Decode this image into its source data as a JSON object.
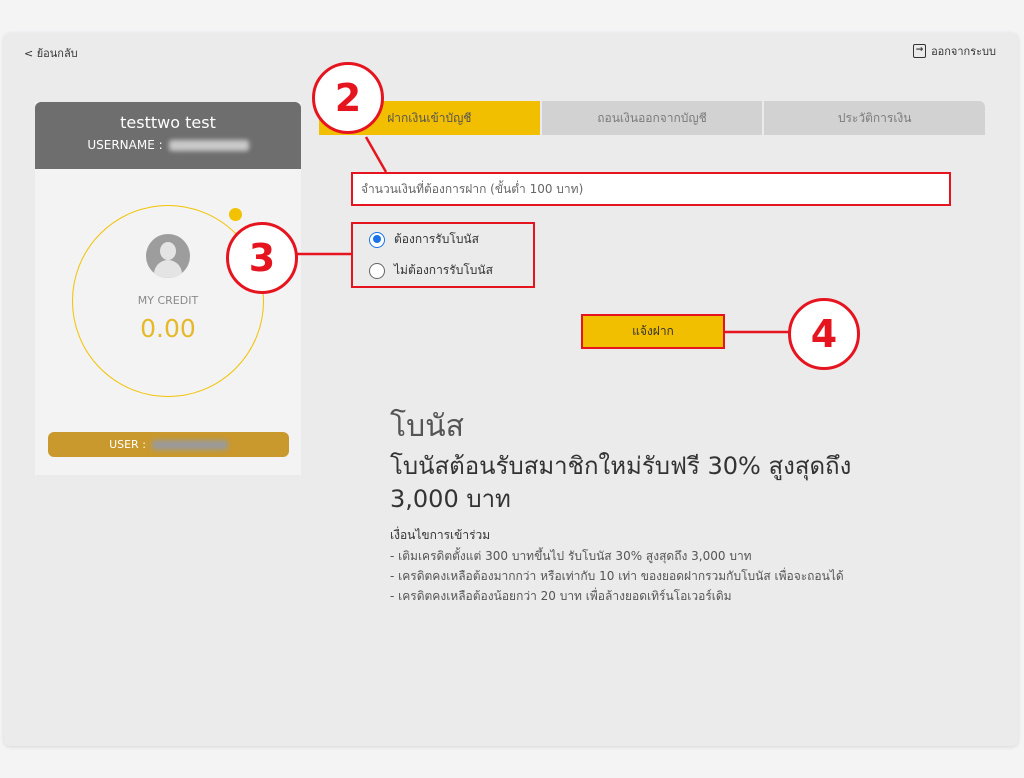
{
  "nav": {
    "back_label": "< ย้อนกลับ",
    "logout_label": "ออกจากระบบ",
    "logout_icon": "logout-icon"
  },
  "profile": {
    "name": "testtwo test",
    "username_label": "USERNAME :",
    "credit_label": "MY CREDIT",
    "credit_value": "0.00",
    "user_label": "USER :",
    "accent_color": "#f2c200"
  },
  "tabs": [
    {
      "label": "ฝากเงินเข้าบัญชี",
      "active": true
    },
    {
      "label": "ถอนเงินออกจากบัญชี",
      "active": false
    },
    {
      "label": "ประวัติการเงิน",
      "active": false
    }
  ],
  "deposit": {
    "amount_placeholder": "จำนวนเงินที่ต้องการฝาก (ขั้นต่ำ 100 บาท)",
    "bonus_options": [
      {
        "label": "ต้องการรับโบนัส",
        "checked": true
      },
      {
        "label": "ไม่ต้องการรับโบนัส",
        "checked": false
      }
    ],
    "submit_label": "แจ้งฝาก"
  },
  "callouts": [
    "2",
    "3",
    "4"
  ],
  "bonus": {
    "title": "โบนัส",
    "headline": "โบนัสต้อนรับสมาชิกใหม่รับฟรี 30% สูงสุดถึง 3,000 บาท",
    "conditions_title": "เงื่อนไขการเข้าร่วม",
    "conditions": [
      "- เติมเครดิตตั้งแต่ 300 บาทขึ้นไป รับโบนัส 30% สูงสุดถึง 3,000 บาท",
      "- เครดิตคงเหลือต้องมากกว่า หรือเท่ากับ 10 เท่า ของยอดฝากรวมกับโบนัส เพื่อจะถอนได้",
      "- เครดิตคงเหลือต้องน้อยกว่า 20 บาท เพื่อล้างยอดเทิร์นโอเวอร์เดิม"
    ]
  },
  "colors": {
    "brand": "#f2be00",
    "annotation": "#e6141e",
    "gold_bar": "#c9992e"
  }
}
